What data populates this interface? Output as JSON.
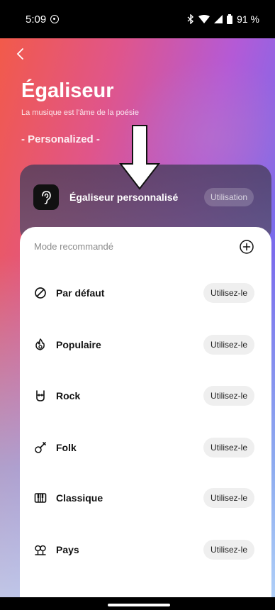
{
  "status_bar": {
    "time": "5:09",
    "battery": "91 %"
  },
  "header": {
    "title": "Égaliseur",
    "subtitle": "La musique est l'âme de la poésie",
    "section_tag": "- Personalized -"
  },
  "custom_eq": {
    "label": "Égaliseur personnalisé",
    "action_label": "Utilisation",
    "icon": "ear-icon"
  },
  "sheet": {
    "header_label": "Mode recommandé",
    "add_icon": "plus-circle-icon",
    "modes": [
      {
        "label": "Par défaut",
        "action": "Utilisez-le",
        "icon": "no-entry-icon"
      },
      {
        "label": "Populaire",
        "action": "Utilisez-le",
        "icon": "flame-icon"
      },
      {
        "label": "Rock",
        "action": "Utilisez-le",
        "icon": "rock-hand-icon"
      },
      {
        "label": "Folk",
        "action": "Utilisez-le",
        "icon": "guitar-icon"
      },
      {
        "label": "Classique",
        "action": "Utilisez-le",
        "icon": "piano-icon"
      },
      {
        "label": "Pays",
        "action": "Utilisez-le",
        "icon": "country-icon"
      }
    ]
  },
  "colors": {
    "gradient_start": "#f25a4a",
    "gradient_mid": "#b45ad6",
    "gradient_end": "#7f7ff0",
    "pill_bg": "#efefef"
  }
}
